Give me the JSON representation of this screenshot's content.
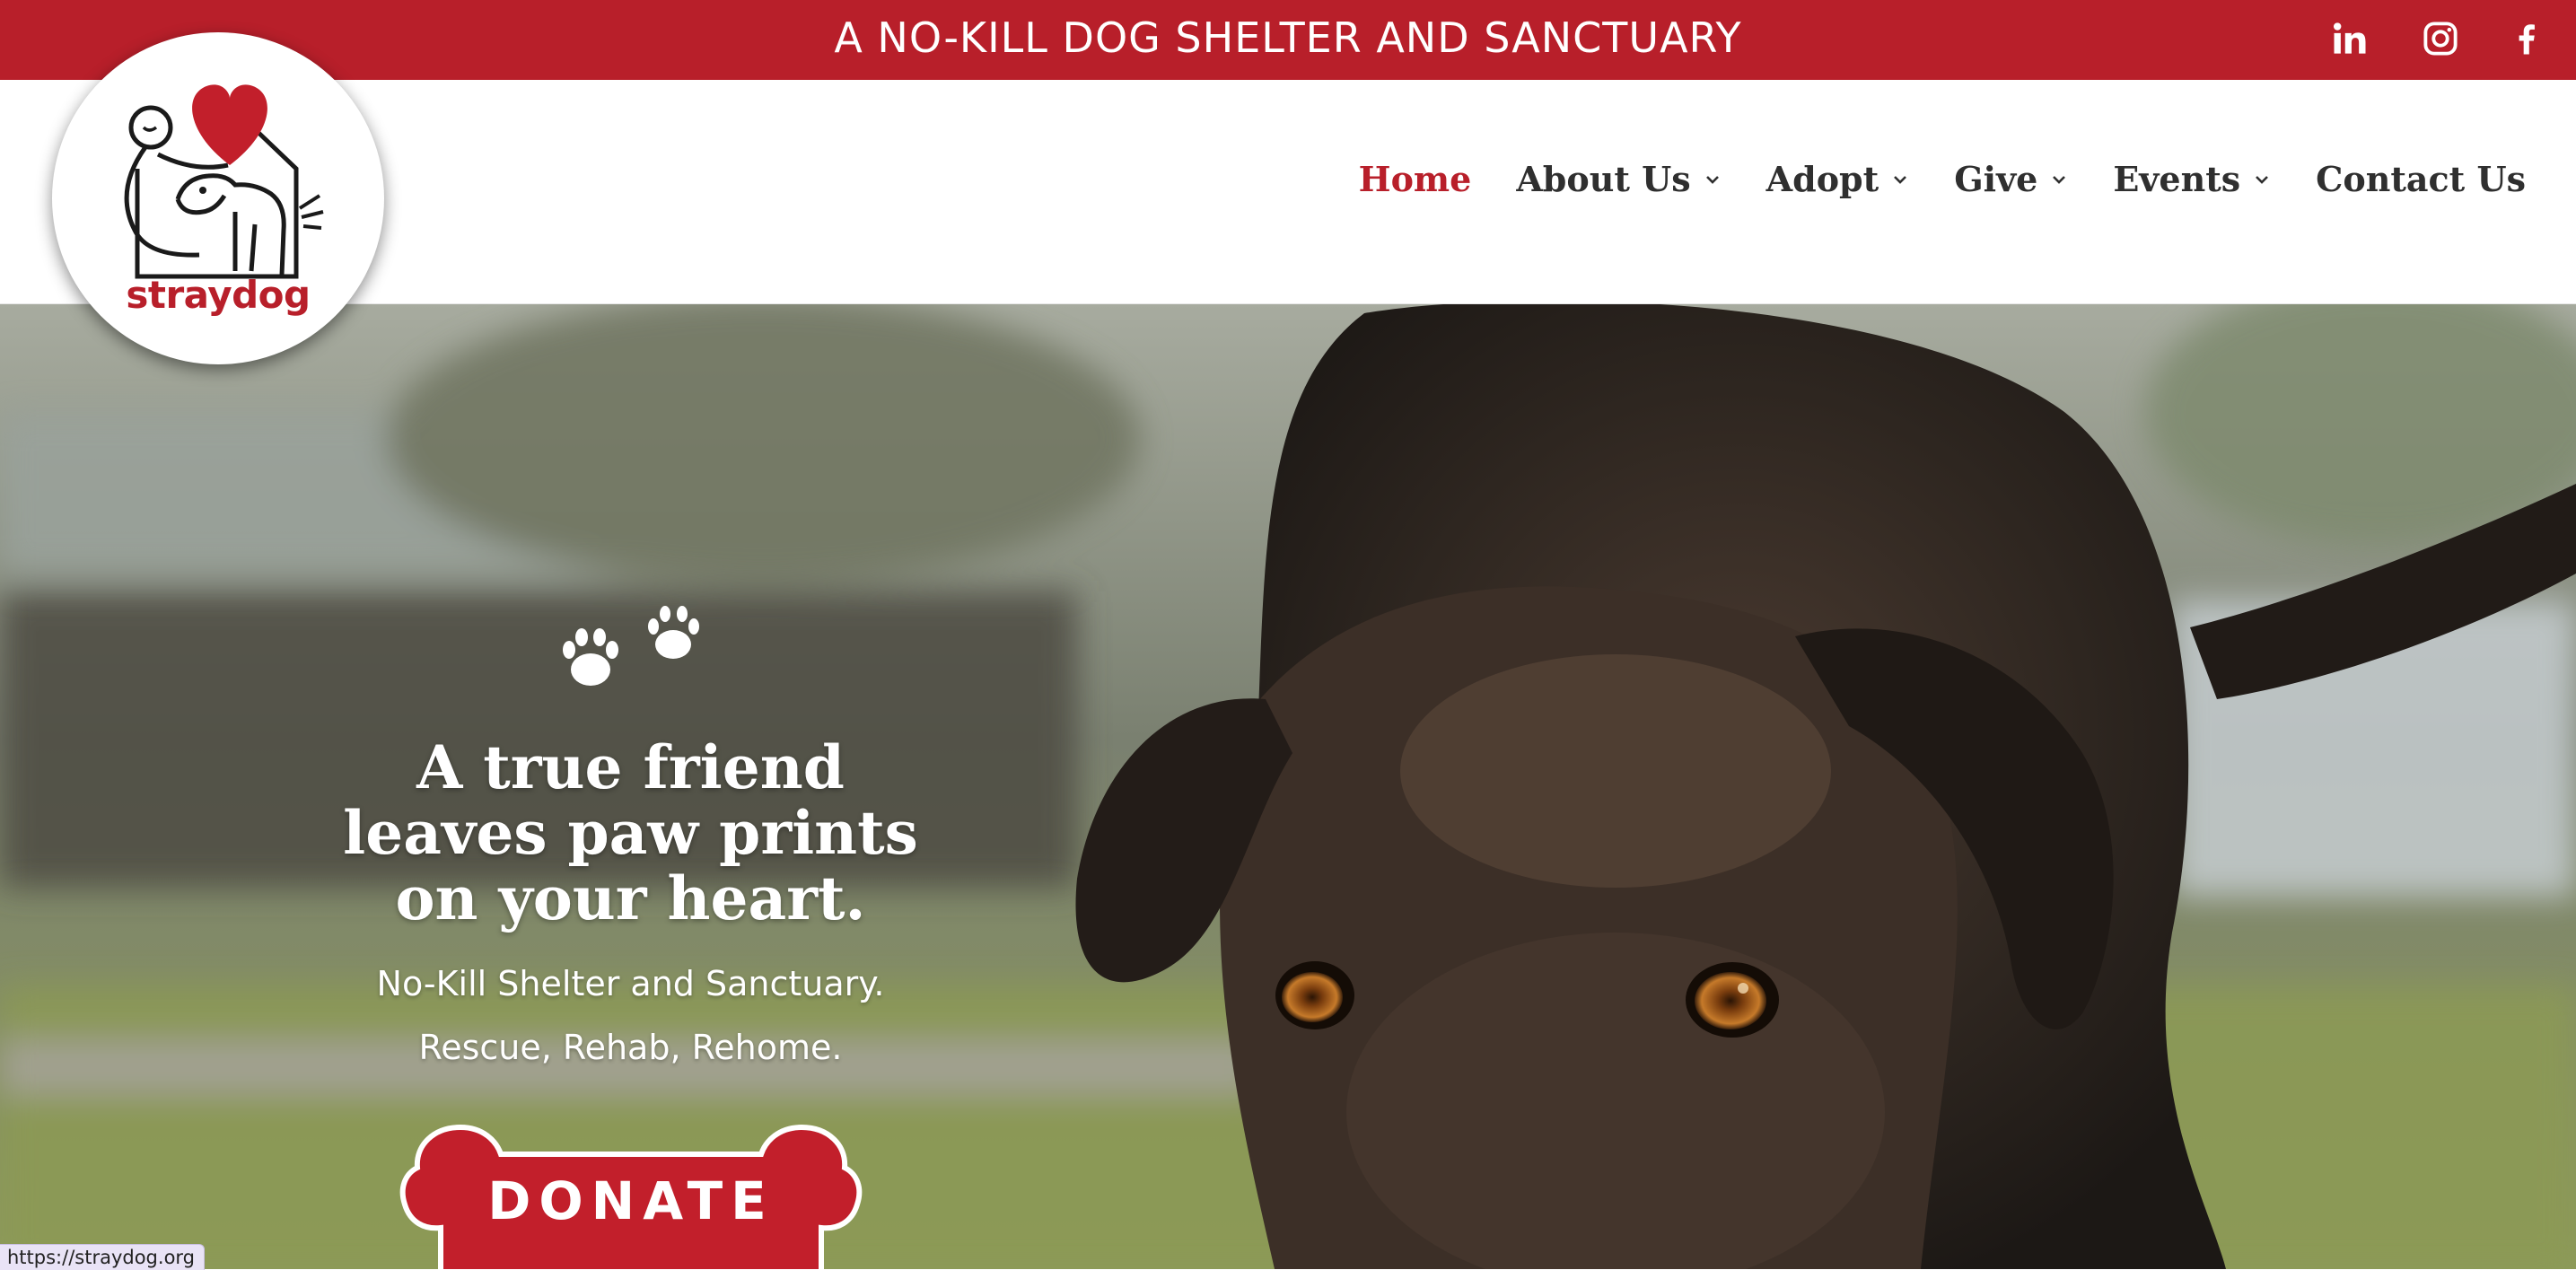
{
  "banner": {
    "title": "A NO-KILL DOG SHELTER AND SANCTUARY",
    "background": "#b81f2a",
    "social": [
      {
        "name": "linkedin",
        "icon": "linkedin-icon"
      },
      {
        "name": "instagram",
        "icon": "instagram-icon"
      },
      {
        "name": "facebook",
        "icon": "facebook-icon"
      }
    ]
  },
  "logo": {
    "text": "straydog",
    "accent": "#b81f2a"
  },
  "nav": {
    "items": [
      {
        "label": "Home",
        "active": true,
        "dropdown": false
      },
      {
        "label": "About Us",
        "active": false,
        "dropdown": true
      },
      {
        "label": "Adopt",
        "active": false,
        "dropdown": true
      },
      {
        "label": "Give",
        "active": false,
        "dropdown": true
      },
      {
        "label": "Events",
        "active": false,
        "dropdown": true
      },
      {
        "label": "Contact Us",
        "active": false,
        "dropdown": false
      }
    ],
    "active_color": "#b81f2a",
    "text_color": "#2f2f2f"
  },
  "hero": {
    "heading": [
      "A true friend",
      "leaves paw prints",
      "on your heart."
    ],
    "subtitle_1": "No-Kill Shelter and Sanctuary.",
    "subtitle_2": "Rescue, Rehab, Rehome.",
    "donate_label": "DONATE",
    "donate_color": "#c21f2b",
    "image": "dog-photo"
  },
  "status_bar": {
    "url": "https://straydog.org"
  }
}
